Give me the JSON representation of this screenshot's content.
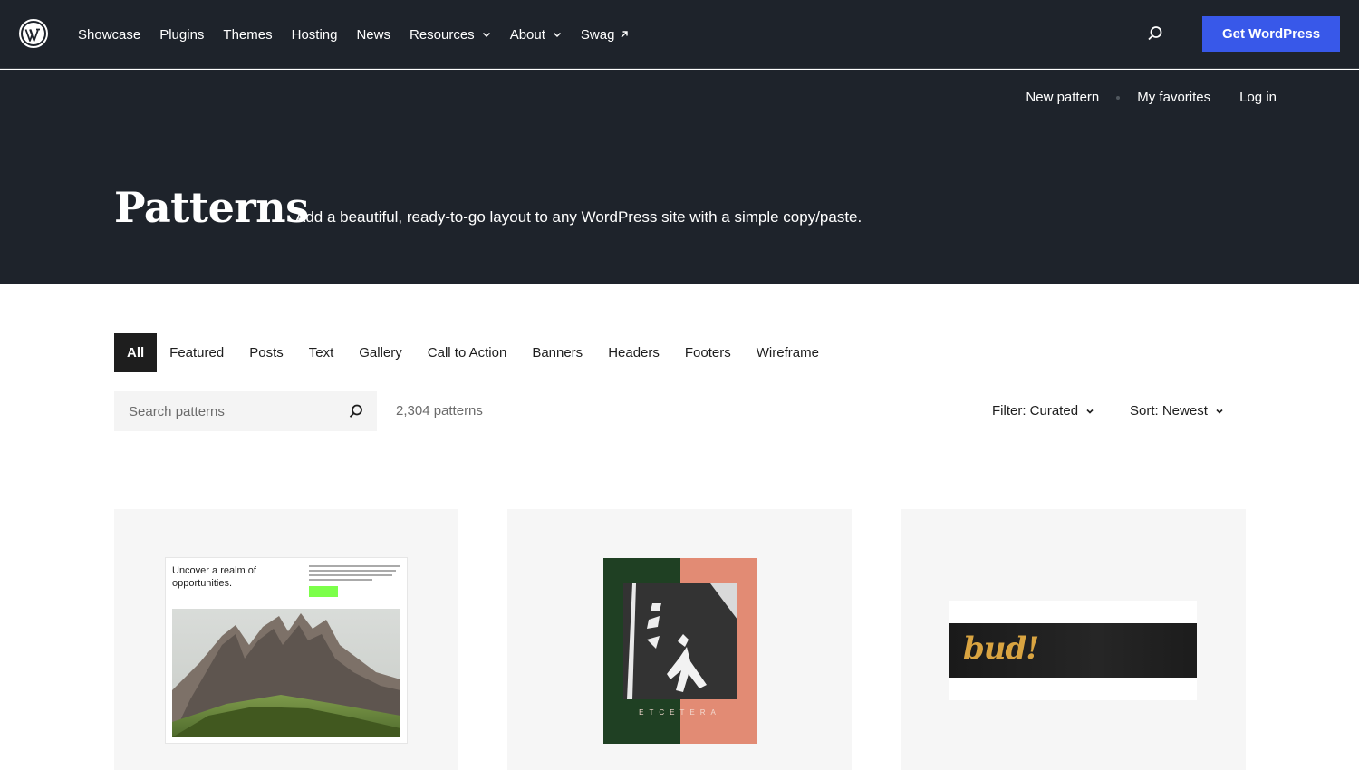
{
  "header": {
    "logo_icon": "wordpress-logo-icon",
    "nav": [
      {
        "label": "Showcase",
        "dropdown": false,
        "external": false
      },
      {
        "label": "Plugins",
        "dropdown": false,
        "external": false
      },
      {
        "label": "Themes",
        "dropdown": false,
        "external": false
      },
      {
        "label": "Hosting",
        "dropdown": false,
        "external": false
      },
      {
        "label": "News",
        "dropdown": false,
        "external": false
      },
      {
        "label": "Resources",
        "dropdown": true,
        "external": false
      },
      {
        "label": "About",
        "dropdown": true,
        "external": false
      },
      {
        "label": "Swag",
        "dropdown": false,
        "external": true
      }
    ],
    "search_icon": "search-icon",
    "cta_label": "Get WordPress",
    "cta_color": "#3858e9",
    "background": "#1e232b"
  },
  "subnav": {
    "new_pattern": "New pattern",
    "my_favorites": "My favorites",
    "log_in": "Log in"
  },
  "hero": {
    "title": "Patterns",
    "description": "Add a beautiful, ready-to-go layout to any WordPress site with a simple copy/paste."
  },
  "categories": [
    {
      "label": "All",
      "active": true
    },
    {
      "label": "Featured",
      "active": false
    },
    {
      "label": "Posts",
      "active": false
    },
    {
      "label": "Text",
      "active": false
    },
    {
      "label": "Gallery",
      "active": false
    },
    {
      "label": "Call to Action",
      "active": false
    },
    {
      "label": "Banners",
      "active": false
    },
    {
      "label": "Headers",
      "active": false
    },
    {
      "label": "Footers",
      "active": false
    },
    {
      "label": "Wireframe",
      "active": false
    }
  ],
  "search": {
    "placeholder": "Search patterns",
    "value": ""
  },
  "count_label": "2,304 patterns",
  "filter_label": "Filter: Curated",
  "sort_label": "Sort: Newest",
  "cards": [
    {
      "heading": "Uncover a realm of opportunities.",
      "button_color": "#7cff4a"
    },
    {
      "word": "ETCETERA",
      "colors": [
        "#1f4023",
        "#e28b74"
      ]
    },
    {
      "word": "bud!",
      "word_color": "#d9a441"
    }
  ]
}
